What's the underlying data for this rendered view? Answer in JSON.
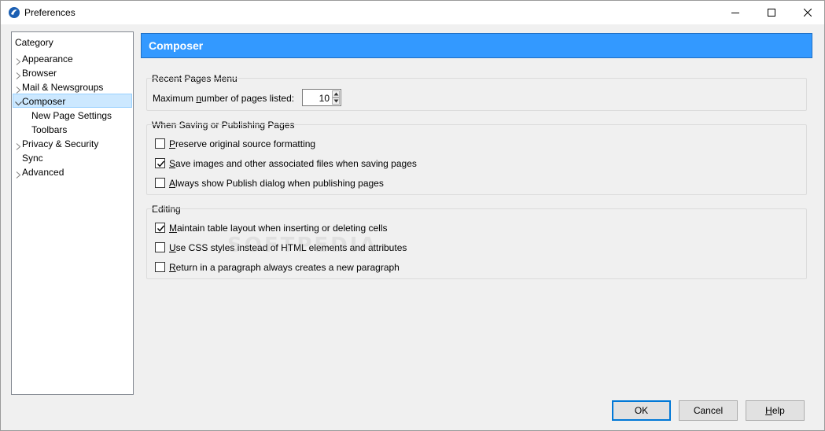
{
  "window": {
    "title": "Preferences"
  },
  "sidebar": {
    "header": "Category",
    "items": [
      {
        "label": "Appearance",
        "expandable": true
      },
      {
        "label": "Browser",
        "expandable": true
      },
      {
        "label": "Mail & Newsgroups",
        "expandable": true
      },
      {
        "label": "Composer",
        "expandable": true,
        "expanded": true,
        "selected": true
      },
      {
        "label": "New Page Settings",
        "child": true
      },
      {
        "label": "Toolbars",
        "child": true
      },
      {
        "label": "Privacy & Security",
        "expandable": true
      },
      {
        "label": "Sync",
        "expandable": false
      },
      {
        "label": "Advanced",
        "expandable": true
      }
    ]
  },
  "pane": {
    "title": "Composer"
  },
  "recent_pages": {
    "group_label": "Recent Pages Menu",
    "max_pages_label_pre": "Maximum ",
    "max_pages_label_u": "n",
    "max_pages_label_post": "umber of pages listed:",
    "max_pages_value": "10"
  },
  "saving": {
    "group_label": "When Saving or Publishing Pages",
    "options": [
      {
        "u": "P",
        "rest": "reserve original source formatting",
        "checked": false
      },
      {
        "u": "S",
        "rest": "ave images and other associated files when saving pages",
        "checked": true
      },
      {
        "u": "A",
        "rest": "lways show Publish dialog when publishing pages",
        "checked": false
      }
    ]
  },
  "editing": {
    "group_label": "Editing",
    "options": [
      {
        "u": "M",
        "rest": "aintain table layout when inserting or deleting cells",
        "checked": true
      },
      {
        "u": "U",
        "rest": "se CSS styles instead of HTML elements and attributes",
        "checked": false
      },
      {
        "u": "R",
        "rest": "eturn in a paragraph always creates a new paragraph",
        "checked": false
      }
    ]
  },
  "watermark": "SOFTPEDIA",
  "buttons": {
    "ok": "OK",
    "cancel": "Cancel",
    "help_u": "H",
    "help_rest": "elp"
  },
  "icons": {
    "app": "seamonkey-app-icon",
    "minimize": "minimize-icon",
    "maximize": "maximize-icon",
    "close": "close-icon",
    "tree_collapsed": "chevron-right-icon",
    "tree_expanded": "chevron-down-icon",
    "check": "checkmark-icon"
  },
  "colors": {
    "accent": "#3399ff",
    "selection": "#cce8ff",
    "default_button_border": "#0078d7"
  }
}
